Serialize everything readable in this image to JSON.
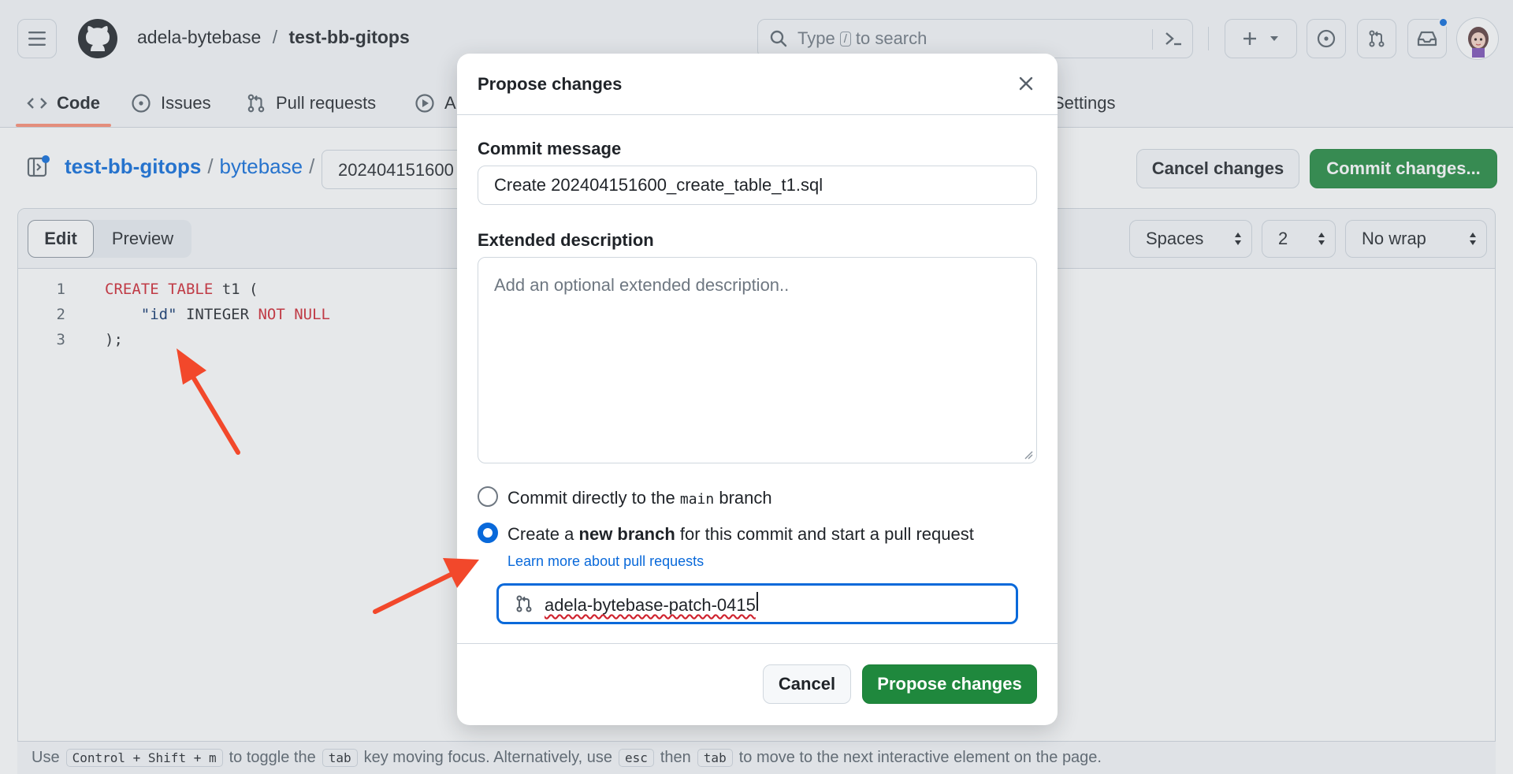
{
  "header": {
    "owner": "adela-bytebase",
    "separator": "/",
    "repo": "test-bb-gitops",
    "search_prefix": "Type",
    "search_key": "/",
    "search_suffix": "to search"
  },
  "tabs": [
    {
      "label": "Code",
      "active": true
    },
    {
      "label": "Issues"
    },
    {
      "label": "Pull requests"
    },
    {
      "label": "A"
    },
    {
      "label": "Settings"
    }
  ],
  "breadcrumb": {
    "repo": "test-bb-gitops",
    "folder": "bytebase",
    "sep": "/",
    "filename_visible": "202404151600"
  },
  "actions": {
    "cancel": "Cancel changes",
    "commit": "Commit changes..."
  },
  "editor": {
    "edit_tab": "Edit",
    "preview_tab": "Preview",
    "indent_mode": "Spaces",
    "indent_size": "2",
    "wrap_mode": "No wrap",
    "lines": [
      {
        "n": "1"
      },
      {
        "n": "2"
      },
      {
        "n": "3"
      }
    ]
  },
  "footer": {
    "t1": "Use",
    "k1": "Control + Shift + m",
    "t2": "to toggle the",
    "k2": "tab",
    "t3": "key moving focus. Alternatively, use",
    "k3": "esc",
    "t4": "then",
    "k4": "tab",
    "t5": "to move to the next interactive element on the page."
  },
  "modal": {
    "title": "Propose changes",
    "commit_message_label": "Commit message",
    "commit_message_value": "Create 202404151600_create_table_t1.sql",
    "extended_label": "Extended description",
    "extended_placeholder": "Add an optional extended description..",
    "option_direct_pre": "Commit directly to the",
    "option_direct_branch": "main",
    "option_direct_post": "branch",
    "option_new_pre": "Create a",
    "option_new_bold": "new branch",
    "option_new_post": "for this commit and start a pull request",
    "learn_more": "Learn more about pull requests",
    "branch_name": "adela-bytebase-patch-0415",
    "cancel": "Cancel",
    "submit": "Propose changes",
    "selected_option": "new_branch"
  },
  "colors": {
    "primary_green": "#1f883d",
    "link_blue": "#0969da",
    "annotation_arrow": "#f2482b"
  }
}
